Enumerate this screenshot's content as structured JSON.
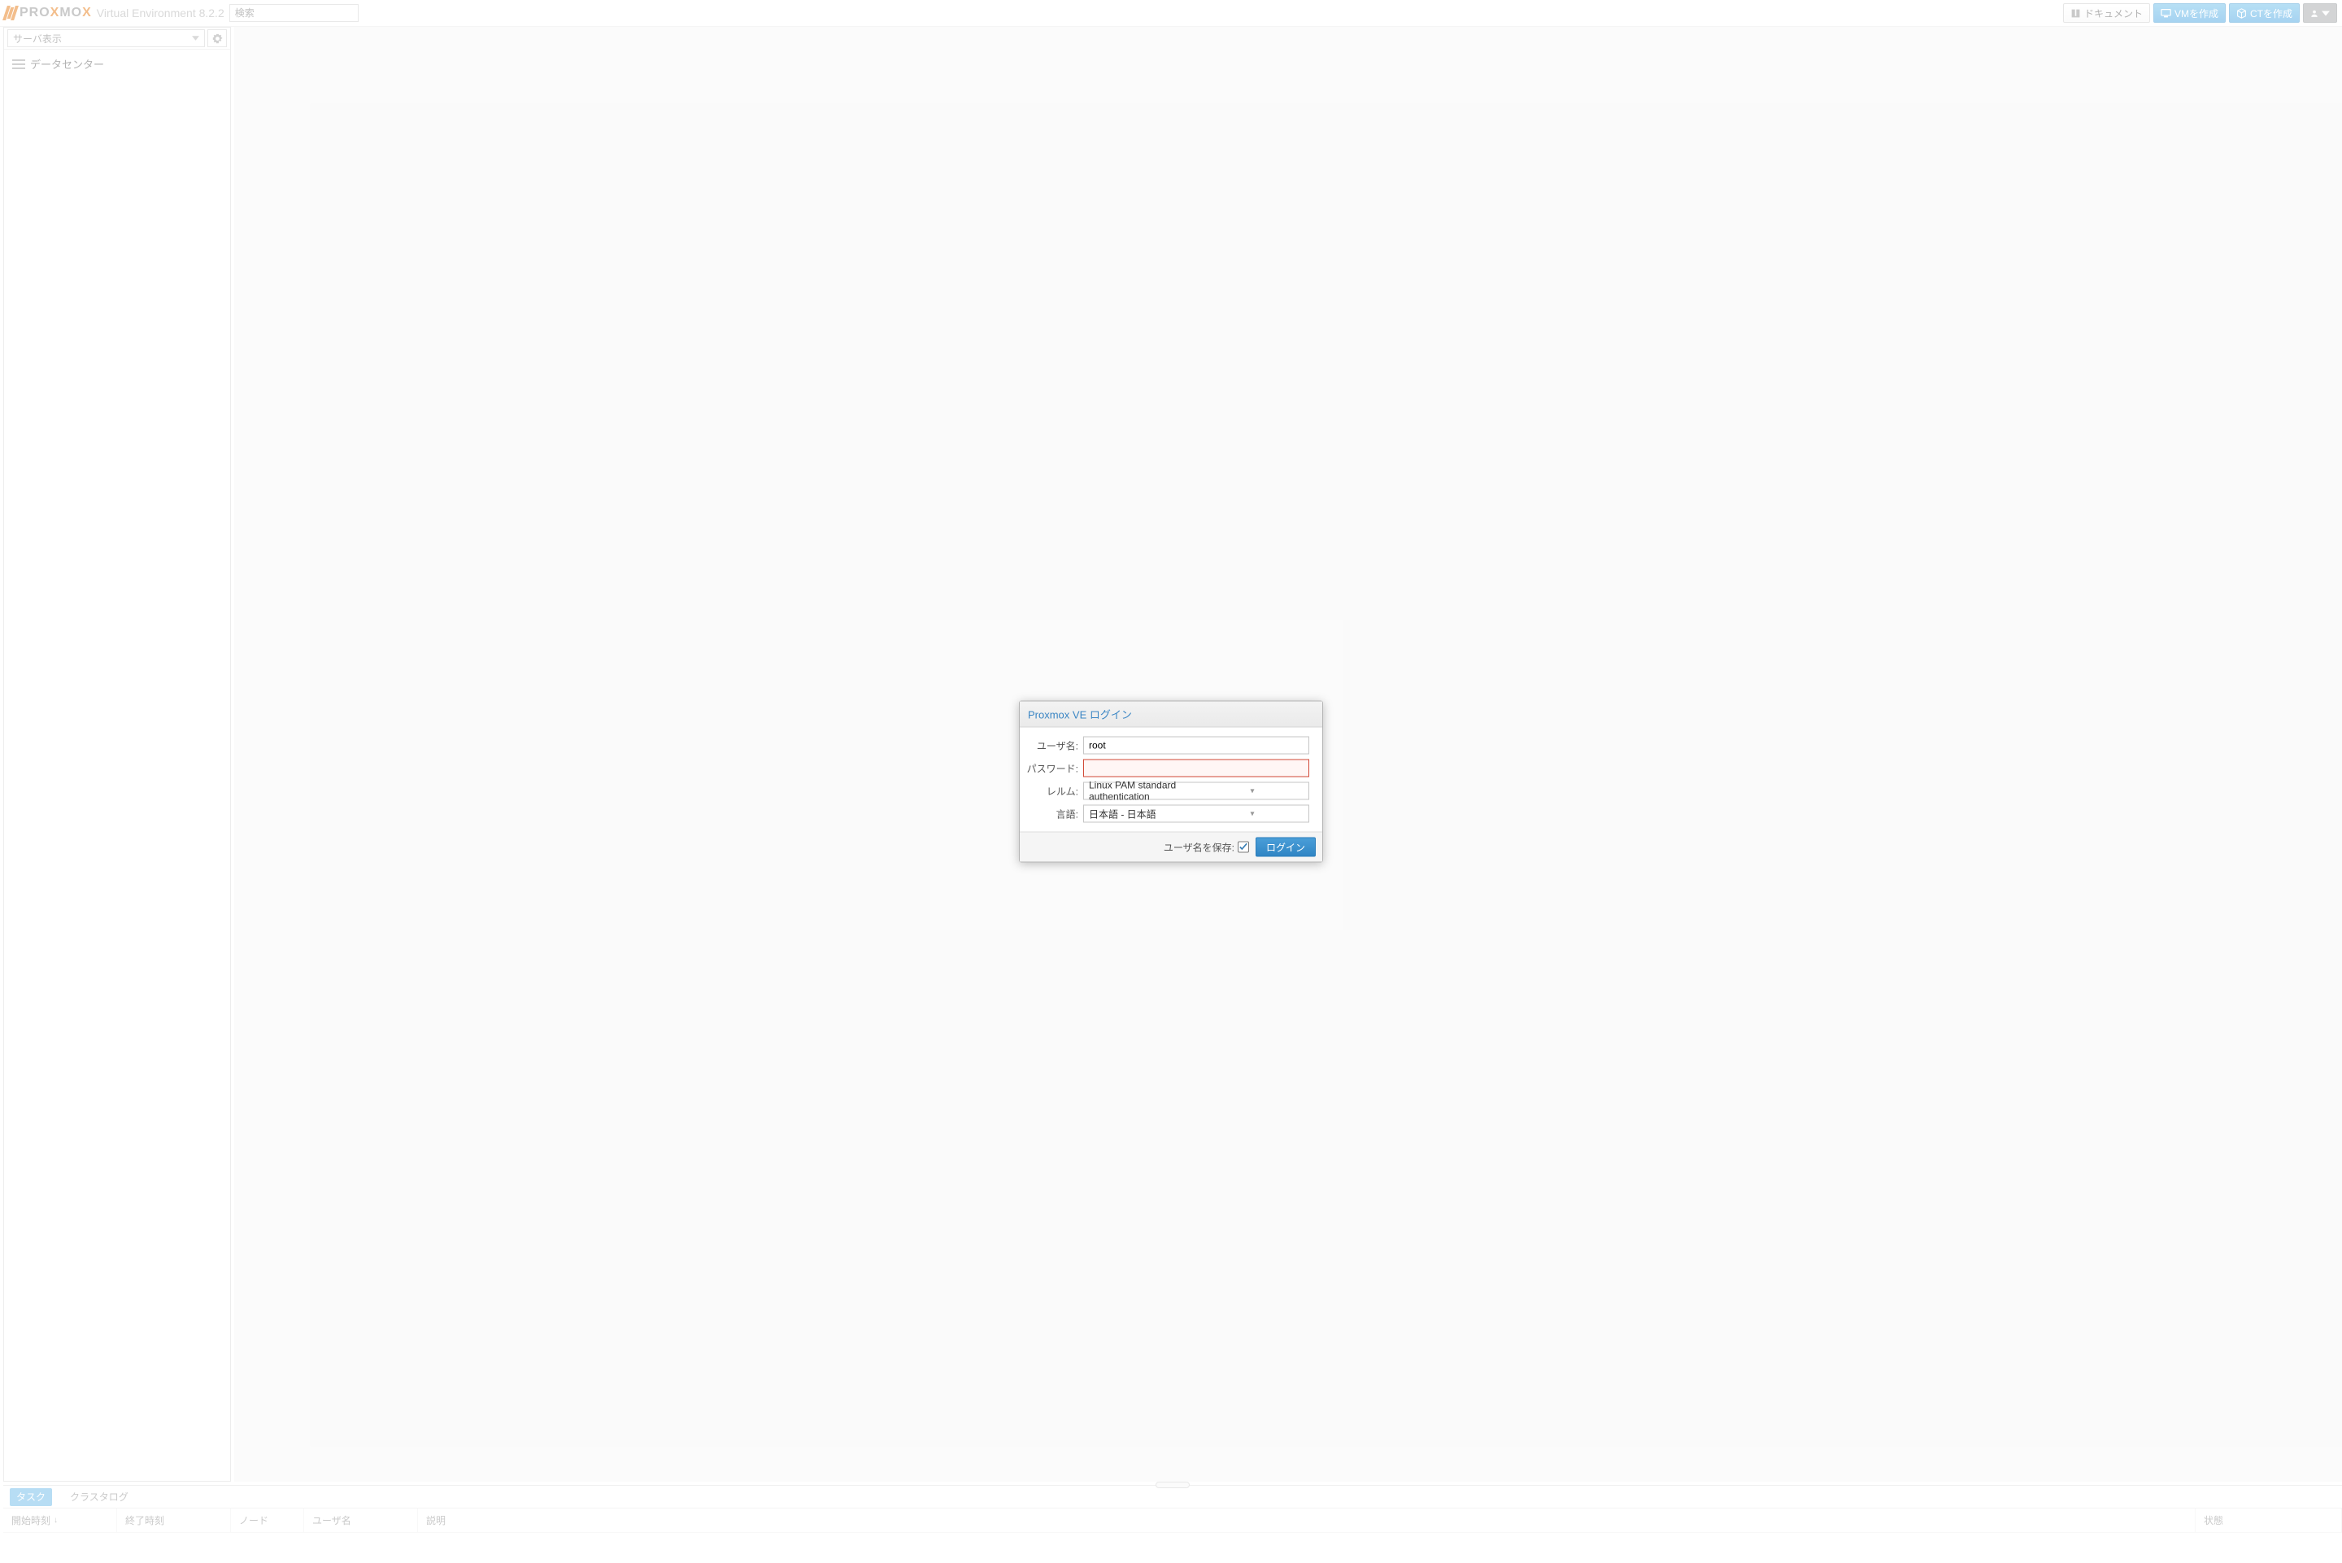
{
  "header": {
    "product": "PROXMOX",
    "title": "Virtual Environment 8.2.2",
    "search_placeholder": "検索",
    "doc_label": "ドキュメント",
    "create_vm_label": "VMを作成",
    "create_ct_label": "CTを作成"
  },
  "sidebar": {
    "view_label": "サーバ表示",
    "tree": {
      "datacenter_label": "データセンター"
    }
  },
  "login": {
    "title": "Proxmox VE ログイン",
    "user_label": "ユーザ名:",
    "user_value": "root",
    "password_label": "パスワード:",
    "password_value": "",
    "realm_label": "レルム:",
    "realm_value": "Linux PAM standard authentication",
    "lang_label": "言語:",
    "lang_value": "日本語 - 日本語",
    "save_user_label": "ユーザ名を保存:",
    "save_user_checked": true,
    "login_btn": "ログイン"
  },
  "bottom": {
    "tab_tasks": "タスク",
    "tab_cluster_log": "クラスタログ",
    "columns": {
      "start": "開始時刻",
      "end": "終了時刻",
      "node": "ノード",
      "user": "ユーザ名",
      "description": "説明",
      "status": "状態"
    }
  }
}
